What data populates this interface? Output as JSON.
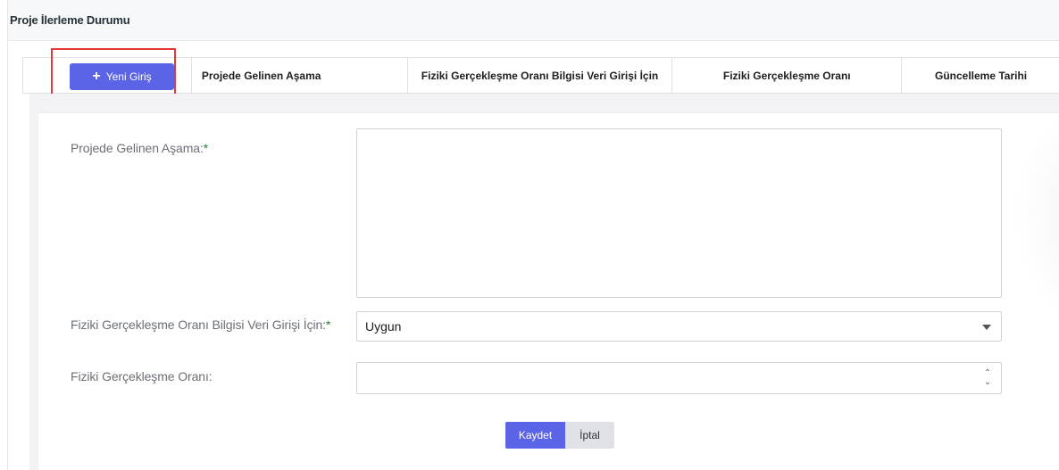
{
  "panel": {
    "title": "Proje İlerleme Durumu"
  },
  "table": {
    "new_button_label": "Yeni Giriş",
    "columns": [
      "Projede Gelinen Aşama",
      "Fiziki Gerçekleşme Oranı Bilgisi Veri Girişi İçin",
      "Fiziki Gerçekleşme Oranı",
      "Güncelleme Tarihi"
    ]
  },
  "form": {
    "stage_label": "Projede Gelinen Aşama:",
    "stage_required": "*",
    "stage_value": "",
    "info_label": "Fiziki Gerçekleşme Oranı Bilgisi Veri Girişi İçin:",
    "info_required": "*",
    "info_selected": "Uygun",
    "rate_label": "Fiziki Gerçekleşme Oranı:",
    "rate_value": "",
    "save_label": "Kaydet",
    "cancel_label": "İptal"
  },
  "colors": {
    "primary": "#5b63e6",
    "highlight": "#e53935",
    "required": "#2e7d32"
  },
  "icons": {
    "add": "plus-icon",
    "dropdown": "chevron-down-icon",
    "spinner": "stepper-icon"
  }
}
